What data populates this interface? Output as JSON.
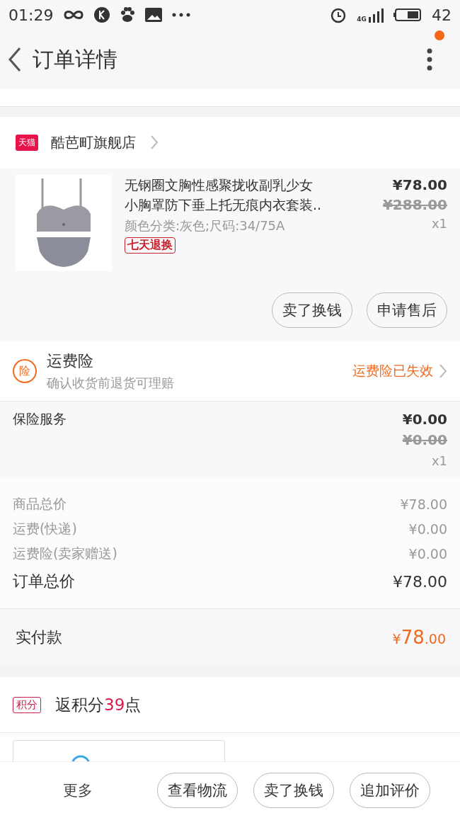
{
  "status_bar": {
    "time": "01:29",
    "network": "4G",
    "battery": "42"
  },
  "header": {
    "title": "订单详情",
    "notification_dot": true
  },
  "store": {
    "name": "酷芭町旗舰店",
    "badge": "天猫"
  },
  "product": {
    "kind": "picture",
    "title": "无钢圈文胸性感聚拢收副乳少女小胸罩防下垂上托无痕内衣套装..",
    "spec": "颜色分类:灰色;尺码:34/75A",
    "tag": "七天退换",
    "price": "¥78.00",
    "original_price": "¥288.00",
    "quantity": "x1",
    "actions": [
      "卖了换钱",
      "申请售后"
    ]
  },
  "shipping_insurance": {
    "badge": "险",
    "title": "运费险",
    "subtitle": "确认收货前退货可理赔",
    "status": "运费险已失效"
  },
  "insurance_service": {
    "label": "保险服务",
    "price": "¥0.00",
    "original_price": "¥0.00",
    "quantity": "x1"
  },
  "summary": [
    {
      "label": "商品总价",
      "value": "¥78.00",
      "kind": "minor"
    },
    {
      "label": "运费(快递)",
      "value": "¥0.00",
      "kind": "minor"
    },
    {
      "label": "运费险(卖家赠送)",
      "value": "¥0.00",
      "kind": "minor"
    },
    {
      "label": "订单总价",
      "value": "¥78.00",
      "kind": "major"
    }
  ],
  "payment": {
    "label": "实付款",
    "currency": "¥",
    "integer": "78",
    "decimal": ".00"
  },
  "points": {
    "badge": "积分",
    "prefix": "返积分",
    "amount": "39",
    "suffix": "点"
  },
  "contact": {
    "kind": "button"
  },
  "bottom_bar": {
    "more": "更多",
    "buttons": [
      "查看物流",
      "卖了换钱",
      "追加评价"
    ]
  }
}
